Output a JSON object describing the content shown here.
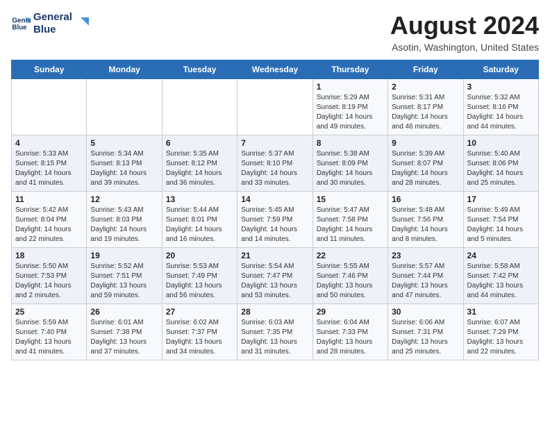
{
  "logo": {
    "line1": "General",
    "line2": "Blue"
  },
  "title": "August 2024",
  "location": "Asotin, Washington, United States",
  "days_of_week": [
    "Sunday",
    "Monday",
    "Tuesday",
    "Wednesday",
    "Thursday",
    "Friday",
    "Saturday"
  ],
  "weeks": [
    [
      {
        "day": "",
        "sunrise": "",
        "sunset": "",
        "daylight": ""
      },
      {
        "day": "",
        "sunrise": "",
        "sunset": "",
        "daylight": ""
      },
      {
        "day": "",
        "sunrise": "",
        "sunset": "",
        "daylight": ""
      },
      {
        "day": "",
        "sunrise": "",
        "sunset": "",
        "daylight": ""
      },
      {
        "day": "1",
        "sunrise": "Sunrise: 5:29 AM",
        "sunset": "Sunset: 8:19 PM",
        "daylight": "Daylight: 14 hours and 49 minutes."
      },
      {
        "day": "2",
        "sunrise": "Sunrise: 5:31 AM",
        "sunset": "Sunset: 8:17 PM",
        "daylight": "Daylight: 14 hours and 46 minutes."
      },
      {
        "day": "3",
        "sunrise": "Sunrise: 5:32 AM",
        "sunset": "Sunset: 8:16 PM",
        "daylight": "Daylight: 14 hours and 44 minutes."
      }
    ],
    [
      {
        "day": "4",
        "sunrise": "Sunrise: 5:33 AM",
        "sunset": "Sunset: 8:15 PM",
        "daylight": "Daylight: 14 hours and 41 minutes."
      },
      {
        "day": "5",
        "sunrise": "Sunrise: 5:34 AM",
        "sunset": "Sunset: 8:13 PM",
        "daylight": "Daylight: 14 hours and 39 minutes."
      },
      {
        "day": "6",
        "sunrise": "Sunrise: 5:35 AM",
        "sunset": "Sunset: 8:12 PM",
        "daylight": "Daylight: 14 hours and 36 minutes."
      },
      {
        "day": "7",
        "sunrise": "Sunrise: 5:37 AM",
        "sunset": "Sunset: 8:10 PM",
        "daylight": "Daylight: 14 hours and 33 minutes."
      },
      {
        "day": "8",
        "sunrise": "Sunrise: 5:38 AM",
        "sunset": "Sunset: 8:09 PM",
        "daylight": "Daylight: 14 hours and 30 minutes."
      },
      {
        "day": "9",
        "sunrise": "Sunrise: 5:39 AM",
        "sunset": "Sunset: 8:07 PM",
        "daylight": "Daylight: 14 hours and 28 minutes."
      },
      {
        "day": "10",
        "sunrise": "Sunrise: 5:40 AM",
        "sunset": "Sunset: 8:06 PM",
        "daylight": "Daylight: 14 hours and 25 minutes."
      }
    ],
    [
      {
        "day": "11",
        "sunrise": "Sunrise: 5:42 AM",
        "sunset": "Sunset: 8:04 PM",
        "daylight": "Daylight: 14 hours and 22 minutes."
      },
      {
        "day": "12",
        "sunrise": "Sunrise: 5:43 AM",
        "sunset": "Sunset: 8:03 PM",
        "daylight": "Daylight: 14 hours and 19 minutes."
      },
      {
        "day": "13",
        "sunrise": "Sunrise: 5:44 AM",
        "sunset": "Sunset: 8:01 PM",
        "daylight": "Daylight: 14 hours and 16 minutes."
      },
      {
        "day": "14",
        "sunrise": "Sunrise: 5:45 AM",
        "sunset": "Sunset: 7:59 PM",
        "daylight": "Daylight: 14 hours and 14 minutes."
      },
      {
        "day": "15",
        "sunrise": "Sunrise: 5:47 AM",
        "sunset": "Sunset: 7:58 PM",
        "daylight": "Daylight: 14 hours and 11 minutes."
      },
      {
        "day": "16",
        "sunrise": "Sunrise: 5:48 AM",
        "sunset": "Sunset: 7:56 PM",
        "daylight": "Daylight: 14 hours and 8 minutes."
      },
      {
        "day": "17",
        "sunrise": "Sunrise: 5:49 AM",
        "sunset": "Sunset: 7:54 PM",
        "daylight": "Daylight: 14 hours and 5 minutes."
      }
    ],
    [
      {
        "day": "18",
        "sunrise": "Sunrise: 5:50 AM",
        "sunset": "Sunset: 7:53 PM",
        "daylight": "Daylight: 14 hours and 2 minutes."
      },
      {
        "day": "19",
        "sunrise": "Sunrise: 5:52 AM",
        "sunset": "Sunset: 7:51 PM",
        "daylight": "Daylight: 13 hours and 59 minutes."
      },
      {
        "day": "20",
        "sunrise": "Sunrise: 5:53 AM",
        "sunset": "Sunset: 7:49 PM",
        "daylight": "Daylight: 13 hours and 56 minutes."
      },
      {
        "day": "21",
        "sunrise": "Sunrise: 5:54 AM",
        "sunset": "Sunset: 7:47 PM",
        "daylight": "Daylight: 13 hours and 53 minutes."
      },
      {
        "day": "22",
        "sunrise": "Sunrise: 5:55 AM",
        "sunset": "Sunset: 7:46 PM",
        "daylight": "Daylight: 13 hours and 50 minutes."
      },
      {
        "day": "23",
        "sunrise": "Sunrise: 5:57 AM",
        "sunset": "Sunset: 7:44 PM",
        "daylight": "Daylight: 13 hours and 47 minutes."
      },
      {
        "day": "24",
        "sunrise": "Sunrise: 5:58 AM",
        "sunset": "Sunset: 7:42 PM",
        "daylight": "Daylight: 13 hours and 44 minutes."
      }
    ],
    [
      {
        "day": "25",
        "sunrise": "Sunrise: 5:59 AM",
        "sunset": "Sunset: 7:40 PM",
        "daylight": "Daylight: 13 hours and 41 minutes."
      },
      {
        "day": "26",
        "sunrise": "Sunrise: 6:01 AM",
        "sunset": "Sunset: 7:38 PM",
        "daylight": "Daylight: 13 hours and 37 minutes."
      },
      {
        "day": "27",
        "sunrise": "Sunrise: 6:02 AM",
        "sunset": "Sunset: 7:37 PM",
        "daylight": "Daylight: 13 hours and 34 minutes."
      },
      {
        "day": "28",
        "sunrise": "Sunrise: 6:03 AM",
        "sunset": "Sunset: 7:35 PM",
        "daylight": "Daylight: 13 hours and 31 minutes."
      },
      {
        "day": "29",
        "sunrise": "Sunrise: 6:04 AM",
        "sunset": "Sunset: 7:33 PM",
        "daylight": "Daylight: 13 hours and 28 minutes."
      },
      {
        "day": "30",
        "sunrise": "Sunrise: 6:06 AM",
        "sunset": "Sunset: 7:31 PM",
        "daylight": "Daylight: 13 hours and 25 minutes."
      },
      {
        "day": "31",
        "sunrise": "Sunrise: 6:07 AM",
        "sunset": "Sunset: 7:29 PM",
        "daylight": "Daylight: 13 hours and 22 minutes."
      }
    ]
  ]
}
